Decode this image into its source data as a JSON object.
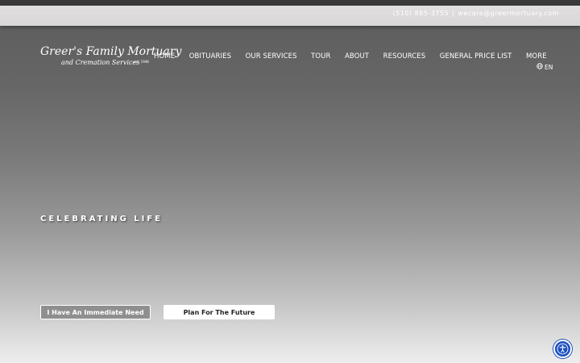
{
  "contact": {
    "phone": "(510) 865-3755",
    "separator": "|",
    "email": "wecare@greermortuary.com"
  },
  "logo": {
    "line1": "Greer's Family Mortuary",
    "line2": "and Cremation Services",
    "est": "est. 1948"
  },
  "nav": {
    "items": [
      "HOME",
      "OBITUARIES",
      "OUR SERVICES",
      "TOUR",
      "ABOUT",
      "RESOURCES",
      "GENERAL PRICE LIST",
      "MORE"
    ]
  },
  "language": {
    "label": "EN",
    "icon": "globe-icon"
  },
  "hero": {
    "tagline": "CELEBRATING LIFE",
    "buttons": {
      "immediate": "I Have An Immediate Need",
      "plan": "Plan For The Future"
    }
  },
  "accessibility": {
    "icon": "accessibility-icon",
    "color": "#1b4fbf"
  }
}
